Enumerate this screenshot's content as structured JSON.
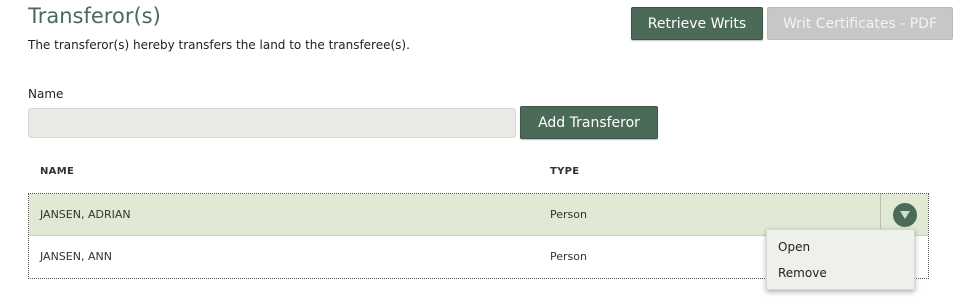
{
  "header": {
    "title": "Transferor(s)",
    "subtitle": "The transferor(s) hereby transfers the land to the transferee(s)."
  },
  "toolbar": {
    "retrieve_writs_label": "Retrieve Writs",
    "writ_certificates_label": "Writ Certificates - PDF"
  },
  "form": {
    "name_label": "Name",
    "name_value": "",
    "add_button_label": "Add Transferor"
  },
  "table": {
    "columns": [
      "NAME",
      "TYPE"
    ],
    "rows": [
      {
        "name": "JANSEN, ADRIAN",
        "type": "Person",
        "selected": true
      },
      {
        "name": "JANSEN, ANN",
        "type": "Person",
        "selected": false
      }
    ]
  },
  "row_menu": {
    "icon": "chevron-down-icon",
    "items": [
      "Open",
      "Remove"
    ]
  },
  "colors": {
    "accent": "#4c6a58",
    "title": "#4a6a5a",
    "selected_row": "#dfe9d3",
    "disabled_button": "#c5c8c6"
  }
}
